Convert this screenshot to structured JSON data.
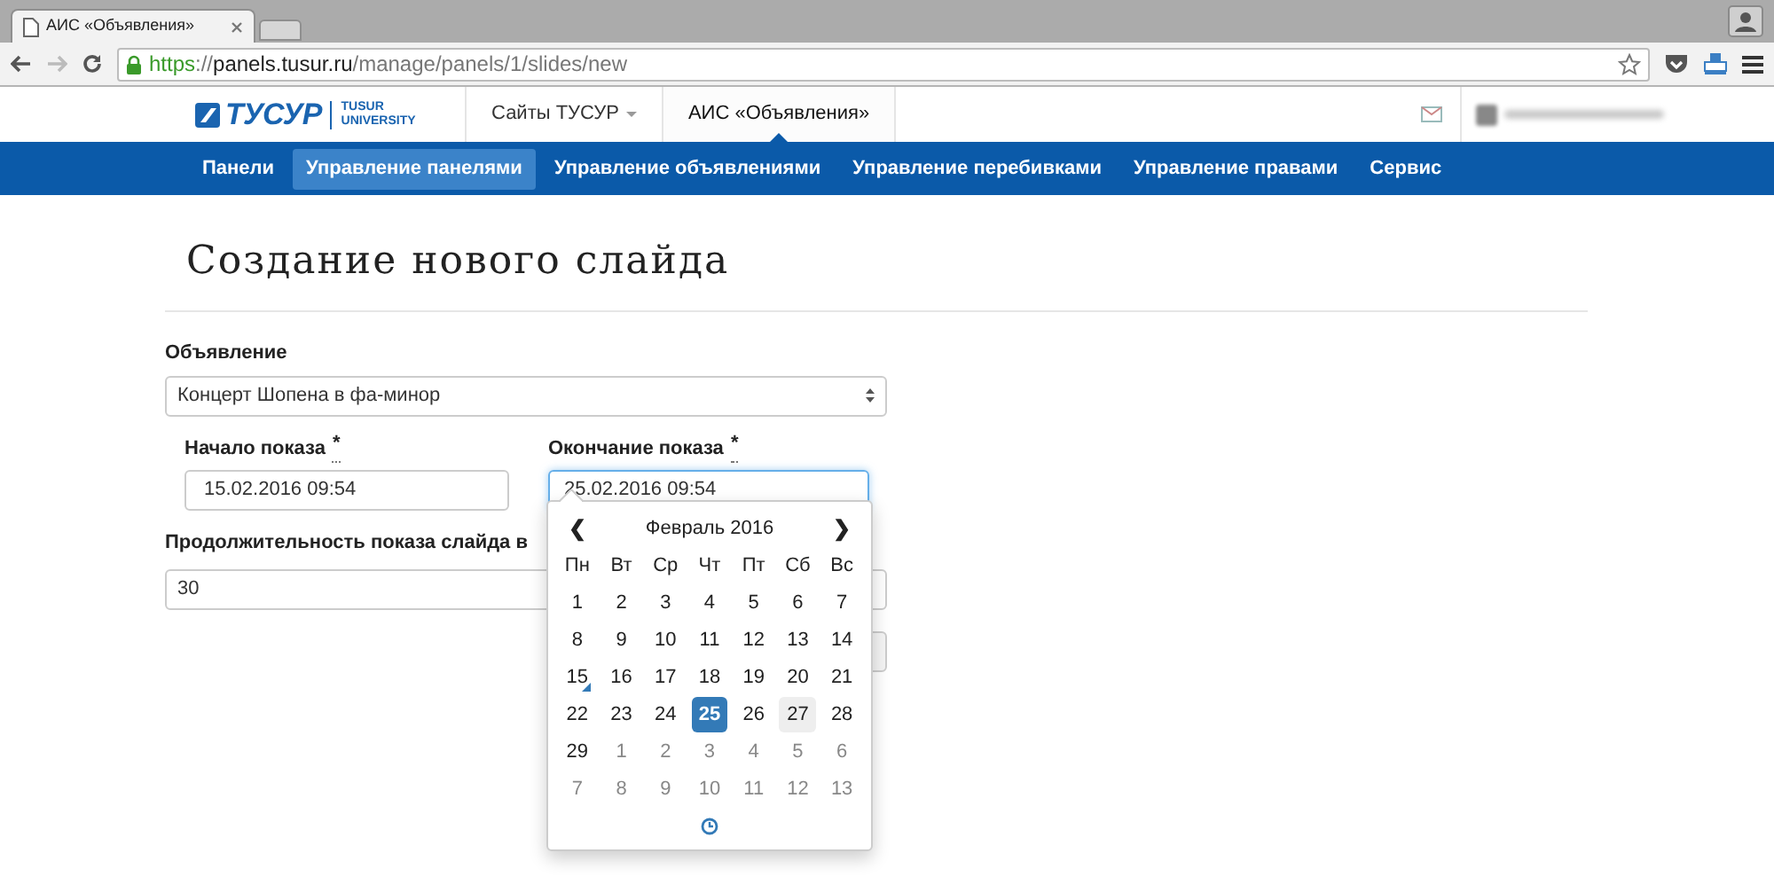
{
  "browser": {
    "tab_title": "АИС «Объявления»",
    "url": {
      "scheme": "https",
      "separator": "://",
      "host": "panels.tusur.ru",
      "path": "/manage/panels/1/slides/new"
    }
  },
  "header": {
    "logo_text": "ТУСУР",
    "logo_caption": [
      "TUSUR",
      "UNIVERSITY"
    ],
    "links": [
      {
        "label": "Сайты ТУСУР",
        "kind": "dropdown",
        "selected": false
      },
      {
        "label": "АИС «Объявления»",
        "kind": "link",
        "selected": true
      }
    ]
  },
  "nav": [
    {
      "label": "Панели",
      "selected": false
    },
    {
      "label": "Управление панелями",
      "selected": true
    },
    {
      "label": "Управление объявлениями",
      "selected": false
    },
    {
      "label": "Управление перебивками",
      "selected": false
    },
    {
      "label": "Управление правами",
      "selected": false
    },
    {
      "label": "Сервис",
      "selected": false
    }
  ],
  "page_title": "Создание нового слайда",
  "form": {
    "announcement": {
      "label": "Объявление",
      "value": "Концерт Шопена в фа-минор"
    },
    "start": {
      "label": "Начало показа",
      "required_mark": "*",
      "value": "15.02.2016 09:54"
    },
    "end": {
      "label": "Окончание показа",
      "required_mark": "*",
      "value": "25.02.2016 09:54",
      "focused": true
    },
    "duration": {
      "label": "Продолжительность показа слайда в",
      "value": "30"
    }
  },
  "datepicker": {
    "prev": "❮",
    "month": "Февраль 2016",
    "next": "❯",
    "weekdays": [
      "Пн",
      "Вт",
      "Ср",
      "Чт",
      "Пт",
      "Сб",
      "Вс"
    ],
    "weeks": [
      [
        {
          "day": "1",
          "other_month": false,
          "selected": false,
          "today": false,
          "highlighted": false
        },
        {
          "day": "2",
          "other_month": false,
          "selected": false,
          "today": false,
          "highlighted": false
        },
        {
          "day": "3",
          "other_month": false,
          "selected": false,
          "today": false,
          "highlighted": false
        },
        {
          "day": "4",
          "other_month": false,
          "selected": false,
          "today": false,
          "highlighted": false
        },
        {
          "day": "5",
          "other_month": false,
          "selected": false,
          "today": false,
          "highlighted": false
        },
        {
          "day": "6",
          "other_month": false,
          "selected": false,
          "today": false,
          "highlighted": false
        },
        {
          "day": "7",
          "other_month": false,
          "selected": false,
          "today": false,
          "highlighted": false
        }
      ],
      [
        {
          "day": "8",
          "other_month": false,
          "selected": false,
          "today": false,
          "highlighted": false
        },
        {
          "day": "9",
          "other_month": false,
          "selected": false,
          "today": false,
          "highlighted": false
        },
        {
          "day": "10",
          "other_month": false,
          "selected": false,
          "today": false,
          "highlighted": false
        },
        {
          "day": "11",
          "other_month": false,
          "selected": false,
          "today": false,
          "highlighted": false
        },
        {
          "day": "12",
          "other_month": false,
          "selected": false,
          "today": false,
          "highlighted": false
        },
        {
          "day": "13",
          "other_month": false,
          "selected": false,
          "today": false,
          "highlighted": false
        },
        {
          "day": "14",
          "other_month": false,
          "selected": false,
          "today": false,
          "highlighted": false
        }
      ],
      [
        {
          "day": "15",
          "other_month": false,
          "selected": false,
          "today": true,
          "highlighted": false
        },
        {
          "day": "16",
          "other_month": false,
          "selected": false,
          "today": false,
          "highlighted": false
        },
        {
          "day": "17",
          "other_month": false,
          "selected": false,
          "today": false,
          "highlighted": false
        },
        {
          "day": "18",
          "other_month": false,
          "selected": false,
          "today": false,
          "highlighted": false
        },
        {
          "day": "19",
          "other_month": false,
          "selected": false,
          "today": false,
          "highlighted": false
        },
        {
          "day": "20",
          "other_month": false,
          "selected": false,
          "today": false,
          "highlighted": false
        },
        {
          "day": "21",
          "other_month": false,
          "selected": false,
          "today": false,
          "highlighted": false
        }
      ],
      [
        {
          "day": "22",
          "other_month": false,
          "selected": false,
          "today": false,
          "highlighted": false
        },
        {
          "day": "23",
          "other_month": false,
          "selected": false,
          "today": false,
          "highlighted": false
        },
        {
          "day": "24",
          "other_month": false,
          "selected": false,
          "today": false,
          "highlighted": false
        },
        {
          "day": "25",
          "other_month": false,
          "selected": true,
          "today": false,
          "highlighted": false
        },
        {
          "day": "26",
          "other_month": false,
          "selected": false,
          "today": false,
          "highlighted": false
        },
        {
          "day": "27",
          "other_month": false,
          "selected": false,
          "today": false,
          "highlighted": true
        },
        {
          "day": "28",
          "other_month": false,
          "selected": false,
          "today": false,
          "highlighted": false
        }
      ],
      [
        {
          "day": "29",
          "other_month": false,
          "selected": false,
          "today": false,
          "highlighted": false
        },
        {
          "day": "1",
          "other_month": true,
          "selected": false,
          "today": false,
          "highlighted": false
        },
        {
          "day": "2",
          "other_month": true,
          "selected": false,
          "today": false,
          "highlighted": false
        },
        {
          "day": "3",
          "other_month": true,
          "selected": false,
          "today": false,
          "highlighted": false
        },
        {
          "day": "4",
          "other_month": true,
          "selected": false,
          "today": false,
          "highlighted": false
        },
        {
          "day": "5",
          "other_month": true,
          "selected": false,
          "today": false,
          "highlighted": false
        },
        {
          "day": "6",
          "other_month": true,
          "selected": false,
          "today": false,
          "highlighted": false
        }
      ],
      [
        {
          "day": "7",
          "other_month": true,
          "selected": false,
          "today": false,
          "highlighted": false
        },
        {
          "day": "8",
          "other_month": true,
          "selected": false,
          "today": false,
          "highlighted": false
        },
        {
          "day": "9",
          "other_month": true,
          "selected": false,
          "today": false,
          "highlighted": false
        },
        {
          "day": "10",
          "other_month": true,
          "selected": false,
          "today": false,
          "highlighted": false
        },
        {
          "day": "11",
          "other_month": true,
          "selected": false,
          "today": false,
          "highlighted": false
        },
        {
          "day": "12",
          "other_month": true,
          "selected": false,
          "today": false,
          "highlighted": false
        },
        {
          "day": "13",
          "other_month": true,
          "selected": false,
          "today": false,
          "highlighted": false
        }
      ]
    ]
  }
}
